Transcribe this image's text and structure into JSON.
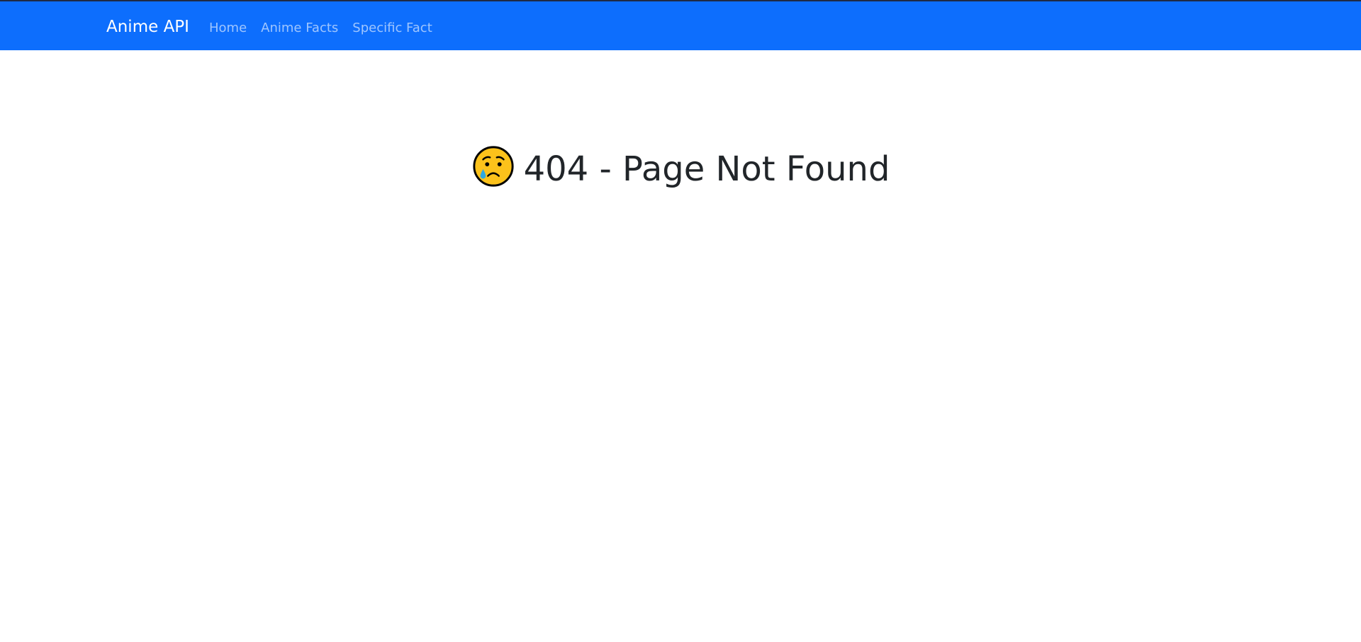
{
  "navbar": {
    "brand": "Anime API",
    "links": [
      {
        "label": "Home"
      },
      {
        "label": "Anime Facts"
      },
      {
        "label": "Specific Fact"
      }
    ],
    "background_color": "#0d6efd"
  },
  "main": {
    "title_icon": "crying-face-icon",
    "title": "404 - Page Not Found",
    "title_color": "#212529"
  }
}
